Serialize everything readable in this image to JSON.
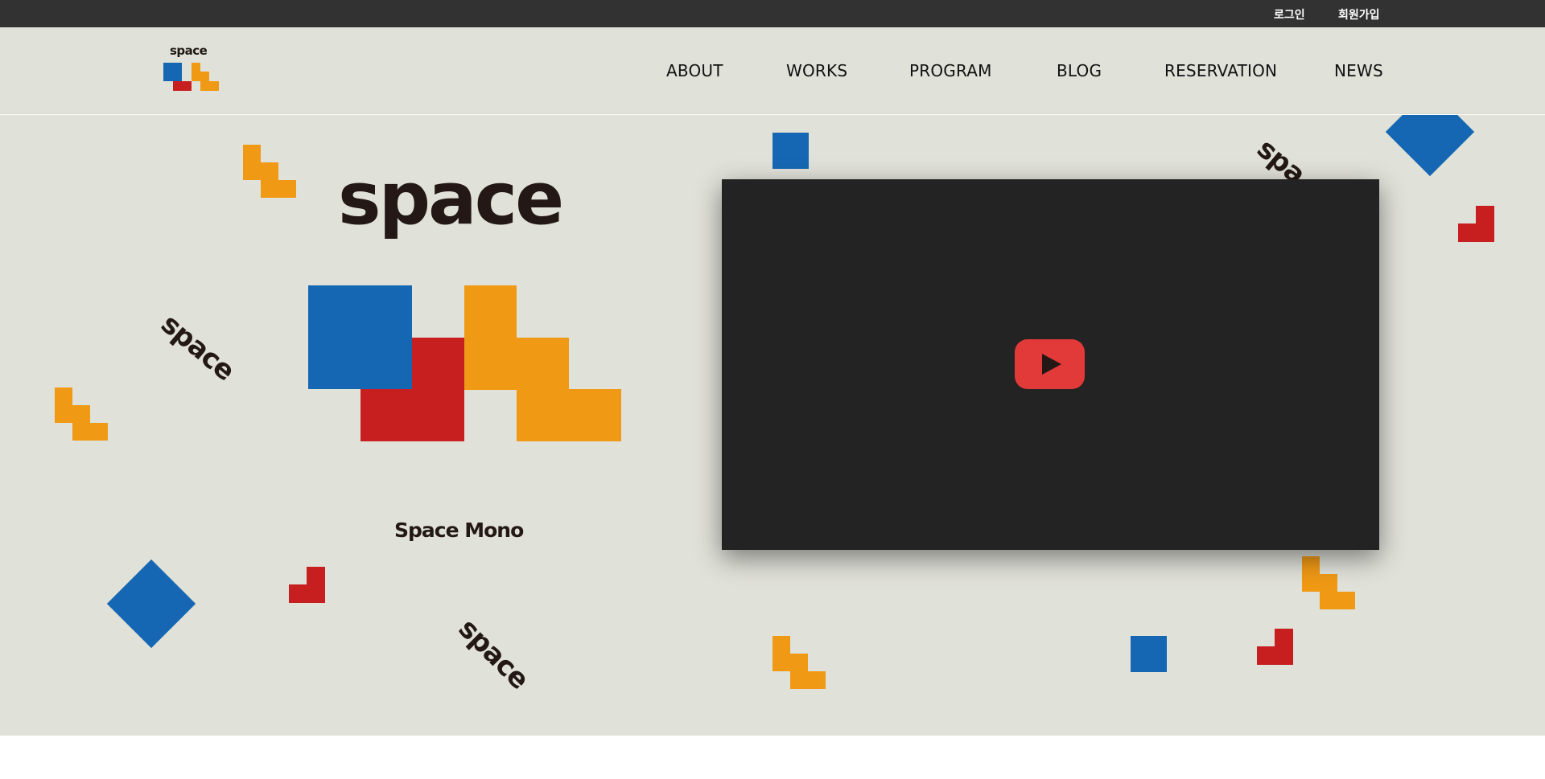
{
  "topbar": {
    "login": "로그인",
    "signup": "회원가입"
  },
  "header": {
    "logo_text": "space",
    "nav": [
      "ABOUT",
      "WORKS",
      "PROGRAM",
      "BLOG",
      "RESERVATION",
      "NEWS"
    ]
  },
  "hero": {
    "title": "space",
    "subtitle": "Space Mono",
    "rotated_words": [
      "space",
      "space",
      "spa"
    ],
    "video": {
      "play_icon": "youtube-play-icon"
    }
  },
  "colors": {
    "topbar": "#323232",
    "background": "#e0e1d9",
    "blue": "#1667b3",
    "red": "#c71f20",
    "orange": "#ef9915",
    "video": "#232323",
    "play": "#e13a39"
  }
}
